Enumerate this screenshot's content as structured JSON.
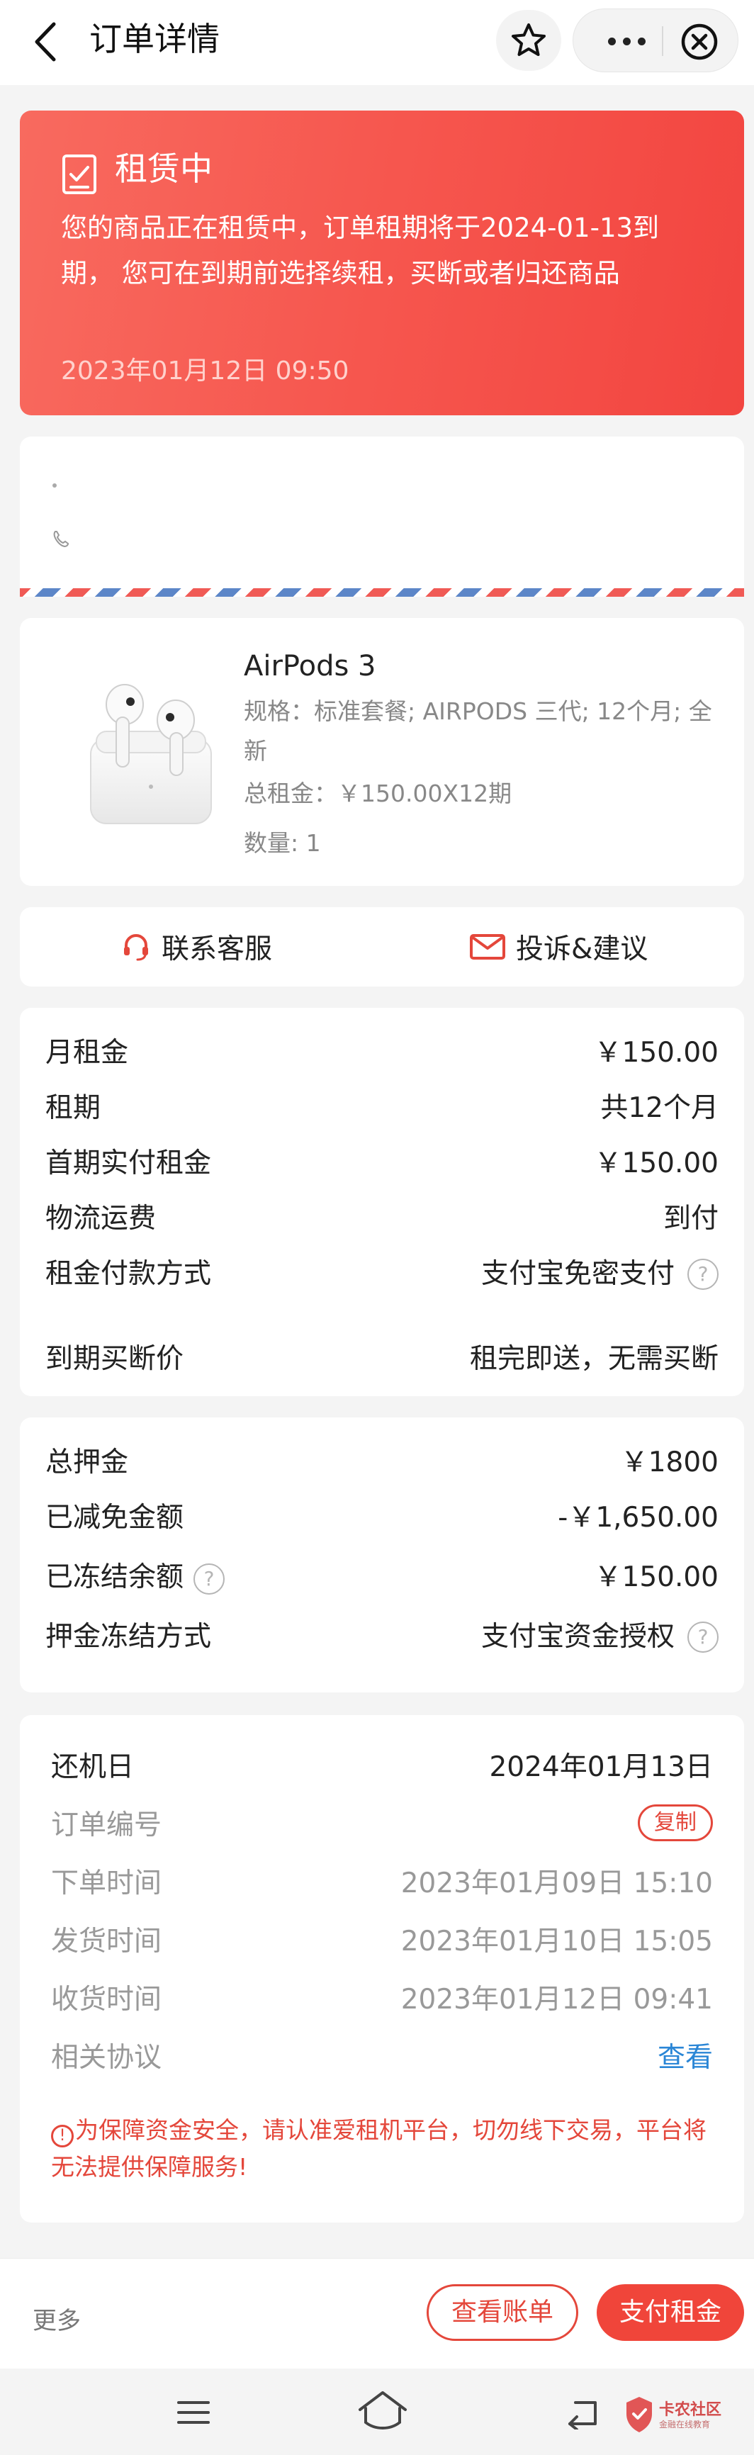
{
  "header": {
    "title": "订单详情"
  },
  "status": {
    "title": "租赁中",
    "description": "您的商品正在租赁中，订单租期将于2024-01-13到期， 您可在到期前选择续租，买断或者归还商品",
    "time": "2023年01月12日 09:50"
  },
  "product": {
    "name": "AirPods 3",
    "spec": "规格：标准套餐; AIRPODS 三代; 12个月; 全新",
    "total": "总租金：￥150.00X12期",
    "qty": "数量: 1"
  },
  "contact": {
    "service_label": "联系客服",
    "complaint_label": "投诉&建议"
  },
  "rent": {
    "rows": [
      {
        "label": "月租金",
        "value": "￥150.00"
      },
      {
        "label": "租期",
        "value": "共12个月"
      },
      {
        "label": "首期实付租金",
        "value": "￥150.00"
      },
      {
        "label": "物流运费",
        "value": "到付"
      },
      {
        "label": "租金付款方式",
        "value": "支付宝免密支付"
      },
      {
        "label": "到期买断价",
        "value": "租完即送，无需买断"
      }
    ]
  },
  "deposit": {
    "rows": [
      {
        "label": "总押金",
        "value": "￥1800"
      },
      {
        "label": "已减免金额",
        "value": "-￥1,650.00"
      },
      {
        "label": "已冻结余额",
        "value": "￥150.00"
      },
      {
        "label": "押金冻结方式",
        "value": "支付宝资金授权"
      }
    ]
  },
  "order": {
    "return_label": "还机日",
    "return_date": "2024年01月13日",
    "order_no_label": "订单编号",
    "copy_label": "复制",
    "order_time_label": "下单时间",
    "order_time": "2023年01月09日 15:10",
    "ship_time_label": "发货时间",
    "ship_time": "2023年01月10日 15:05",
    "receive_time_label": "收货时间",
    "receive_time": "2023年01月12日 09:41",
    "agreement_label": "相关协议",
    "agreement_link": "查看",
    "warning": "为保障资金安全，请认准爱租机平台，切勿线下交易，平台将无法提供保障服务!"
  },
  "bottom": {
    "more": "更多",
    "bill_button": "查看账单",
    "pay_button": "支付租金"
  },
  "watermark": {
    "title": "卡农社区",
    "subtitle": "金融在线教育"
  },
  "colors": {
    "accent": "#f0453a",
    "status_gradient_start": "#f86a5f",
    "status_gradient_end": "#f24540",
    "link": "#2a86d6"
  }
}
